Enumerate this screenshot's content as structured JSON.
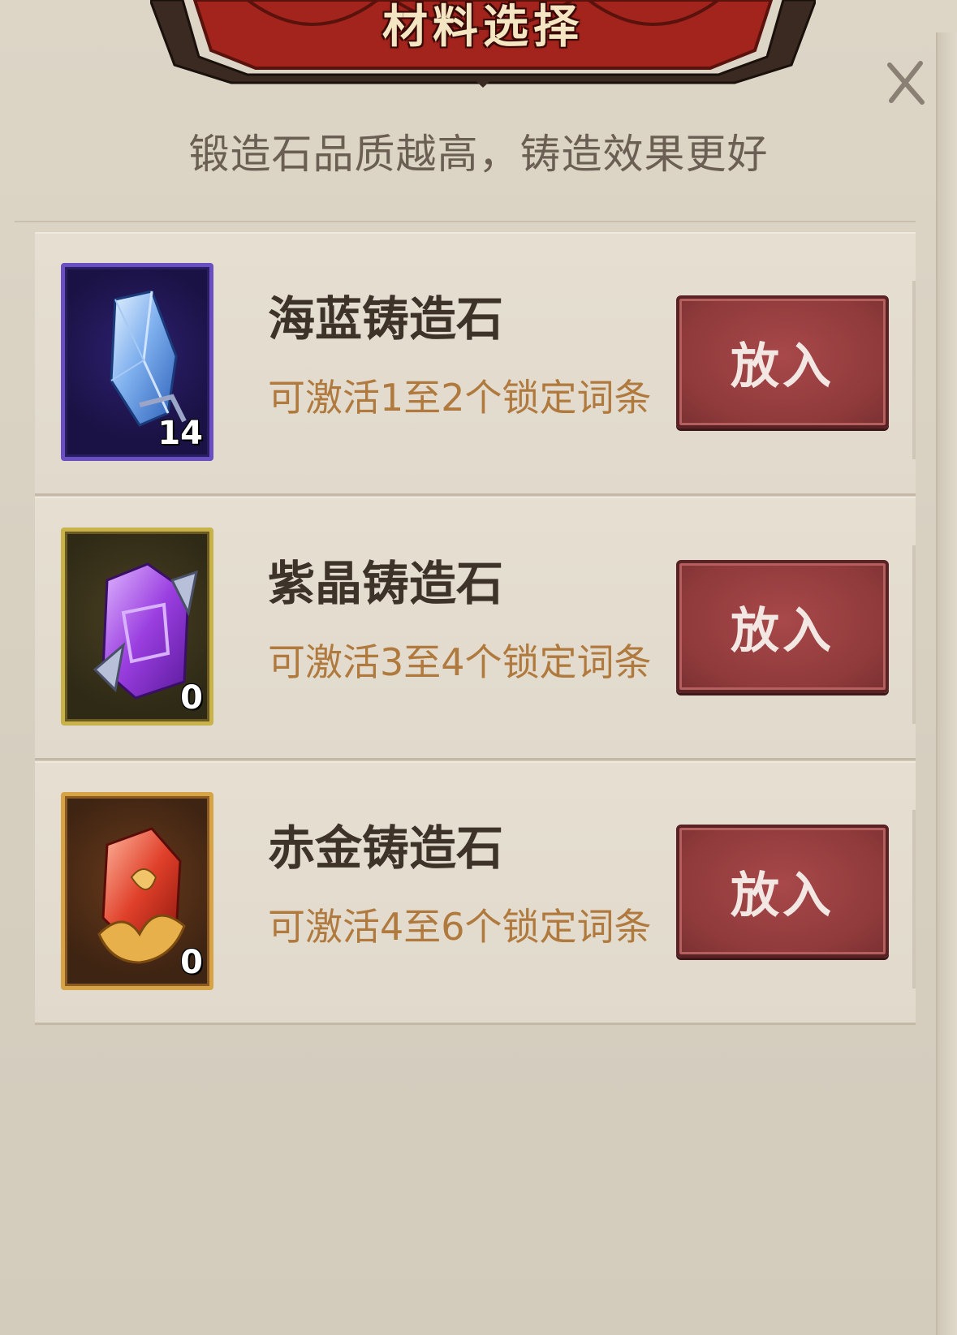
{
  "dialog": {
    "title": "材料选择",
    "subtitle": "锻造石品质越高，铸造效果更好",
    "close_icon": "close-icon"
  },
  "items": [
    {
      "name": "海蓝铸造石",
      "description": "可激活1至2个锁定词条",
      "count": "14",
      "icon": "blue-crystal-icon",
      "button_label": "放入",
      "frame_color": "#6a4fc2"
    },
    {
      "name": "紫晶铸造石",
      "description": "可激活3至4个锁定词条",
      "count": "0",
      "icon": "purple-crystal-icon",
      "button_label": "放入",
      "frame_color": "#c8b24a"
    },
    {
      "name": "赤金铸造石",
      "description": "可激活4至6个锁定词条",
      "count": "0",
      "icon": "red-gold-crystal-icon",
      "button_label": "放入",
      "frame_color": "#d6a347"
    }
  ]
}
